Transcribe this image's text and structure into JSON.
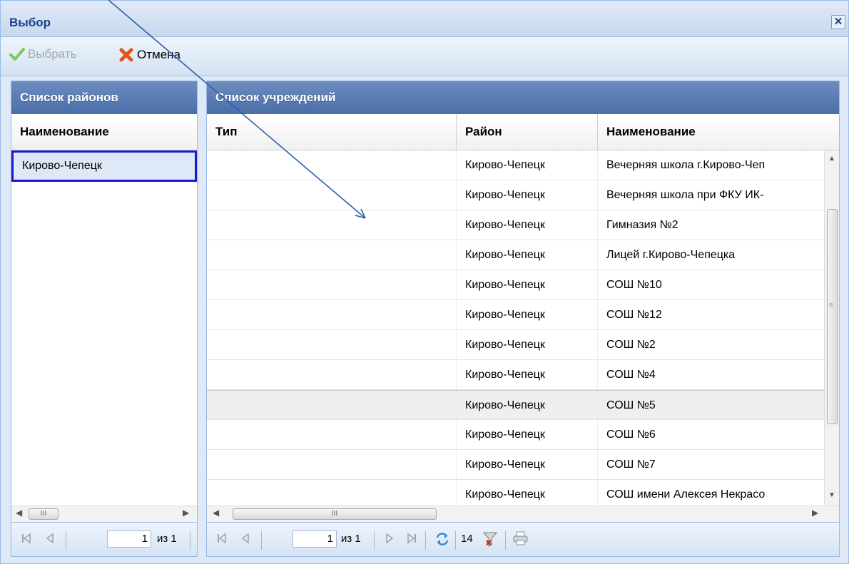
{
  "window": {
    "title": "Выбор",
    "close_glyph": "✕"
  },
  "toolbar": {
    "select_label": "Выбрать",
    "cancel_label": "Отмена"
  },
  "left_panel": {
    "title": "Список районов",
    "column_header": "Наименование",
    "rows": [
      "Кирово-Чепецк"
    ],
    "pager": {
      "page": "1",
      "of_label": "из 1"
    }
  },
  "right_panel": {
    "title": "Список учреждений",
    "columns": [
      "Тип",
      "Район",
      "Наименование"
    ],
    "rows": [
      {
        "type": "",
        "district": "Кирово-Чепецк",
        "name": "Вечерняя школа г.Кирово-Чеп"
      },
      {
        "type": "",
        "district": "Кирово-Чепецк",
        "name": "Вечерняя школа при ФКУ ИК-"
      },
      {
        "type": "",
        "district": "Кирово-Чепецк",
        "name": "Гимназия №2"
      },
      {
        "type": "",
        "district": "Кирово-Чепецк",
        "name": "Лицей г.Кирово-Чепецка"
      },
      {
        "type": "",
        "district": "Кирово-Чепецк",
        "name": "СОШ №10"
      },
      {
        "type": "",
        "district": "Кирово-Чепецк",
        "name": "СОШ №12"
      },
      {
        "type": "",
        "district": "Кирово-Чепецк",
        "name": "СОШ №2"
      },
      {
        "type": "",
        "district": "Кирово-Чепецк",
        "name": "СОШ №4"
      },
      {
        "type": "",
        "district": "Кирово-Чепецк",
        "name": "СОШ №5"
      },
      {
        "type": "",
        "district": "Кирово-Чепецк",
        "name": "СОШ №6"
      },
      {
        "type": "",
        "district": "Кирово-Чепецк",
        "name": "СОШ №7"
      },
      {
        "type": "",
        "district": "Кирово-Чепецк",
        "name": "СОШ имени Алексея Некрасо"
      }
    ],
    "pager": {
      "page": "1",
      "of_label": "из 1",
      "count": "14"
    }
  },
  "icons": {
    "select": "check-icon",
    "cancel": "cross-icon",
    "close": "close-icon",
    "first": "first-page-icon",
    "prev": "prev-page-icon",
    "next": "next-page-icon",
    "last": "last-page-icon",
    "refresh": "refresh-icon",
    "filter": "clear-filter-icon",
    "print": "print-icon"
  },
  "colors": {
    "title": "#15428b",
    "panel_header": "#4a6ea9",
    "selection_border": "#1a1acc",
    "annotation": "#2f5fa8"
  }
}
